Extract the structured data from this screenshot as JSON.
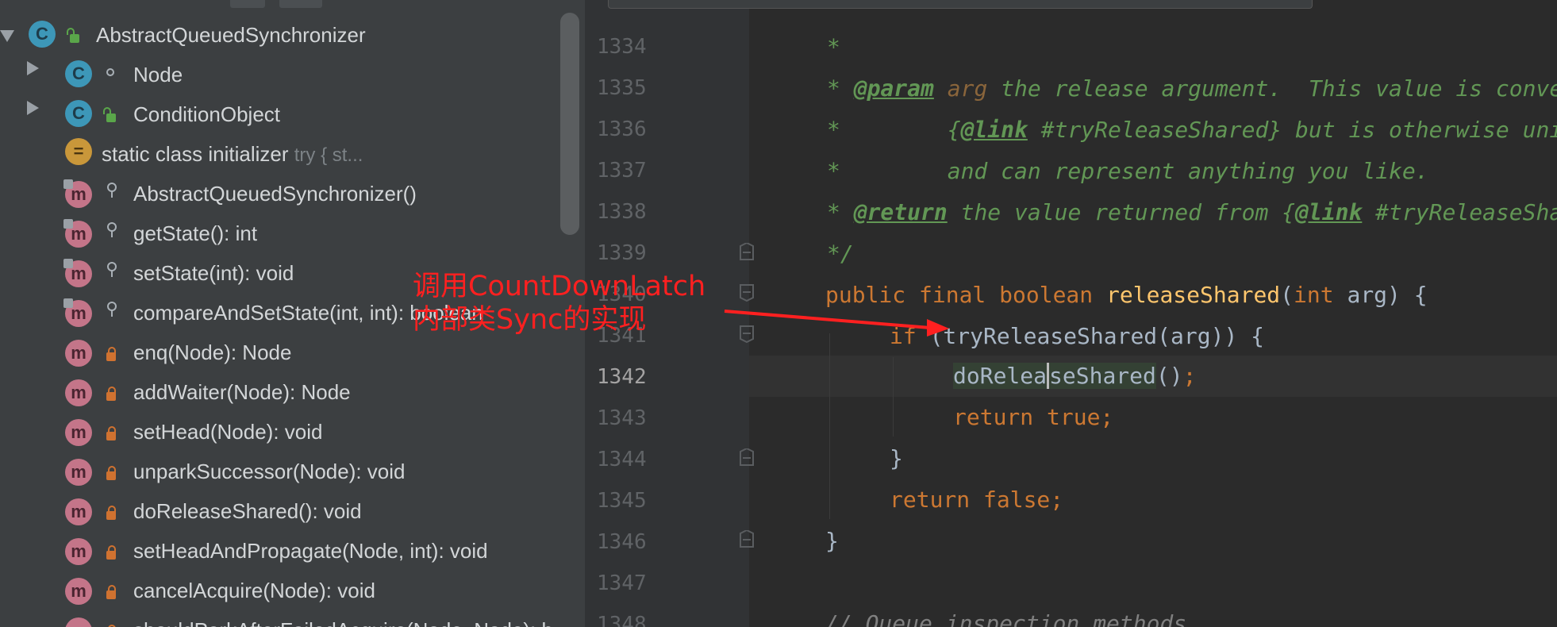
{
  "structure_panel": {
    "items": [
      {
        "label": "AbstractQueuedSynchronizer",
        "kind": "class",
        "visibility": "public",
        "expanded": true
      },
      {
        "label": "Node",
        "kind": "class",
        "visibility": "package-private",
        "expandable": true
      },
      {
        "label": "ConditionObject",
        "kind": "class",
        "visibility": "public",
        "expandable": true
      },
      {
        "label": "static class initializer",
        "hint": "try {              st...",
        "kind": "initializer"
      },
      {
        "label": "AbstractQueuedSynchronizer()",
        "kind": "method",
        "visibility": "protected"
      },
      {
        "label": "getState(): int",
        "kind": "method",
        "visibility": "protected"
      },
      {
        "label": "setState(int): void",
        "kind": "method",
        "visibility": "protected"
      },
      {
        "label": "compareAndSetState(int, int): boolean",
        "kind": "method",
        "visibility": "protected"
      },
      {
        "label": "enq(Node): Node",
        "kind": "method",
        "visibility": "private"
      },
      {
        "label": "addWaiter(Node): Node",
        "kind": "method",
        "visibility": "private"
      },
      {
        "label": "setHead(Node): void",
        "kind": "method",
        "visibility": "private"
      },
      {
        "label": "unparkSuccessor(Node): void",
        "kind": "method",
        "visibility": "private"
      },
      {
        "label": "doReleaseShared(): void",
        "kind": "method",
        "visibility": "private"
      },
      {
        "label": "setHeadAndPropagate(Node, int): void",
        "kind": "method",
        "visibility": "private"
      },
      {
        "label": "cancelAcquire(Node): void",
        "kind": "method",
        "visibility": "private"
      },
      {
        "label": "shouldParkAfterFailedAcquire(Node, Node): boolean",
        "kind": "method",
        "visibility": "private"
      }
    ]
  },
  "editor": {
    "lines": [
      {
        "num": "1334",
        "text": "     *"
      },
      {
        "num": "1335",
        "text": "     * @param arg the release argument.  This value is conveyed to"
      },
      {
        "num": "1336",
        "text": "     *        {@link #tryReleaseShared} but is otherwise uninterpreted"
      },
      {
        "num": "1337",
        "text": "     *        and can represent anything you like."
      },
      {
        "num": "1338",
        "text": "     * @return the value returned from {@link #tryReleaseShared}"
      },
      {
        "num": "1339",
        "text": "     */"
      },
      {
        "num": "1340",
        "text": "    public final boolean releaseShared(int arg) {"
      },
      {
        "num": "1341",
        "text": "        if (tryReleaseShared(arg)) {"
      },
      {
        "num": "1342",
        "text": "            doReleaseShared();"
      },
      {
        "num": "1343",
        "text": "            return true;"
      },
      {
        "num": "1344",
        "text": "        }"
      },
      {
        "num": "1345",
        "text": "        return false;"
      },
      {
        "num": "1346",
        "text": "    }"
      },
      {
        "num": "1347",
        "text": ""
      },
      {
        "num": "1348",
        "text": "    // Queue inspection methods"
      }
    ],
    "current_line": "1342"
  },
  "annotation": {
    "line1": "调用CountDownLatch",
    "line2": "内部类Sync的实现",
    "color": "#ff2020"
  },
  "colors": {
    "keyword": "#cc7832",
    "function": "#ffc66d",
    "javadoc": "#629755",
    "comment": "#808080",
    "identifier": "#a9b7c6"
  }
}
